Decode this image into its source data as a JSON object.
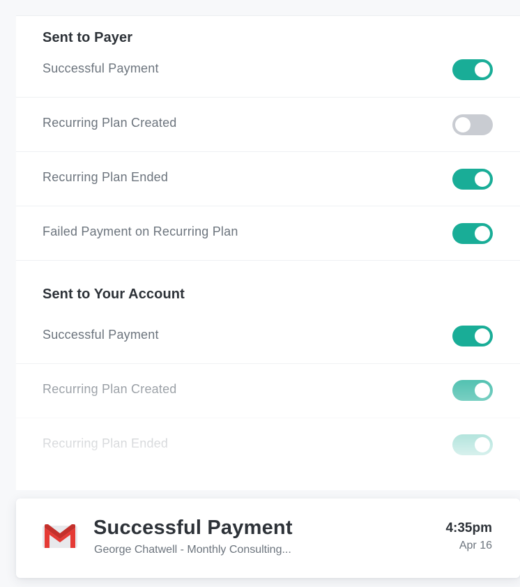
{
  "sections": [
    {
      "title": "Sent to Payer",
      "items": [
        {
          "label": "Successful Payment",
          "enabled": true
        },
        {
          "label": "Recurring Plan Created",
          "enabled": false
        },
        {
          "label": "Recurring Plan Ended",
          "enabled": true
        },
        {
          "label": "Failed Payment on Recurring Plan",
          "enabled": true
        }
      ]
    },
    {
      "title": "Sent to Your Account",
      "items": [
        {
          "label": "Successful Payment",
          "enabled": true
        },
        {
          "label": "Recurring Plan Created",
          "enabled": true
        },
        {
          "label": "Recurring Plan Ended",
          "enabled": true
        }
      ]
    }
  ],
  "notification": {
    "icon": "gmail-icon",
    "title": "Successful Payment",
    "subtitle": "George Chatwell - Monthly Consulting...",
    "time": "4:35pm",
    "date": "Apr 16"
  },
  "colors": {
    "toggle_on": "#19ad97",
    "toggle_off": "#c9ccd2",
    "gmail_red": "#e53a35"
  }
}
